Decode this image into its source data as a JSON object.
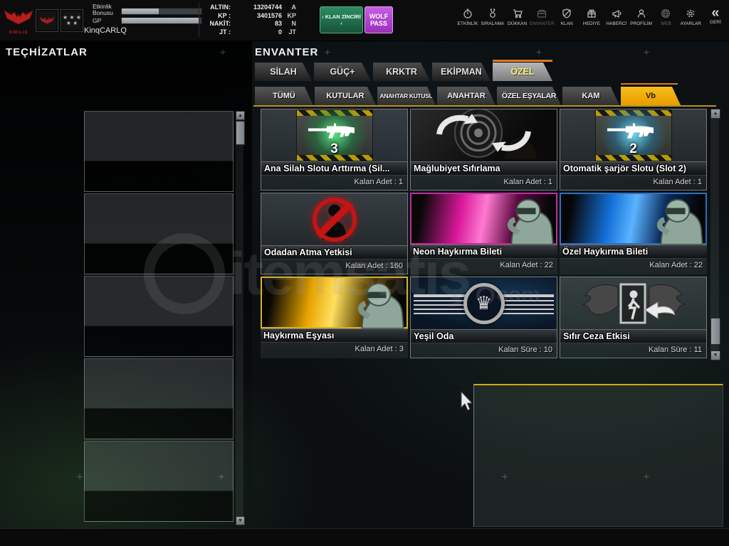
{
  "topbar": {
    "logo_text": "DİRİLİŞ",
    "stars_row1": "★ ★ ★",
    "stars_row2": "★ ★",
    "player": {
      "bonus_label_1": "Etkinlik",
      "bonus_label_2": "Bonusu",
      "gp_label": "GP",
      "name": "KinqCARLQ",
      "bonus_fill": "width:46%",
      "gp_fill": "width:96%"
    },
    "currency": {
      "r0l": "ALTIN:",
      "r0v": "13204744",
      "r0u": "A",
      "r1l": "KP :",
      "r1v": "3401576",
      "r1u": "KP",
      "r2l": "NAKİT:",
      "r2v": "83",
      "r2u": "N",
      "r3l": "JT :",
      "r3v": "0",
      "r3u": "JT"
    },
    "klan_button": "› KLAN ZİNCİRİ ‹",
    "wolfpass_1": "WOLF",
    "wolfpass_2": "PASS",
    "nav": [
      "ETKİNLİK",
      "SIRALAMA",
      "DÜKKAN",
      "ENVANTER",
      "KLAN",
      "HEDİYE",
      "HABERCİ",
      "PROFİLİM",
      "WEB",
      "AYARLAR",
      "GERİ"
    ],
    "back_glyph": "«"
  },
  "left_panel": {
    "title": "TEÇHİZATLAR"
  },
  "inventory": {
    "title": "ENVANTER",
    "tabs": [
      "SİLAH",
      "GÜÇ+",
      "KRKTR",
      "EKİPMAN",
      "ÖZEL"
    ],
    "subtabs": [
      "TÜMÜ",
      "KUTULAR",
      "ANAHTAR KUTUSU",
      "ANAHTAR",
      "ÖZEL EŞYALAR",
      "KAM",
      "Vb"
    ],
    "items": [
      {
        "name": "Ana Silah Slotu Arttırma (Sil...",
        "count": "Kalan Adet : 1",
        "badge": "3"
      },
      {
        "name": "Mağlubiyet  Sıfırlama",
        "count": "Kalan Adet : 1"
      },
      {
        "name": "Otomatik şarjör Slotu (Slot 2)",
        "count": "Kalan Adet : 1",
        "badge": "2"
      },
      {
        "name": "Odadan Atma Yetkisi",
        "count": "Kalan Adet : 160"
      },
      {
        "name": "Neon Haykırma Bileti",
        "count": "Kalan Adet : 22"
      },
      {
        "name": "Özel Haykırma Bileti",
        "count": "Kalan Adet : 22"
      },
      {
        "name": "Haykırma Eşyası",
        "count": "Kalan Adet : 3"
      },
      {
        "name": "Yeşil Oda",
        "count": "Kalan Süre : 10"
      },
      {
        "name": "Sıfır Ceza Etkisi",
        "count": "Kalan Süre : 11"
      }
    ]
  },
  "watermark": {
    "brand": "itemsatış",
    "tld": "com"
  },
  "decor": {
    "plus": "+",
    "up": "▲",
    "down": "▼",
    "crown": "♛"
  },
  "colors": {
    "accent_orange": "#e07820",
    "subtab_active": "#f2ac00",
    "klan_green": "#1d6b4a",
    "wolfpass_purple": "#b44fd0"
  }
}
